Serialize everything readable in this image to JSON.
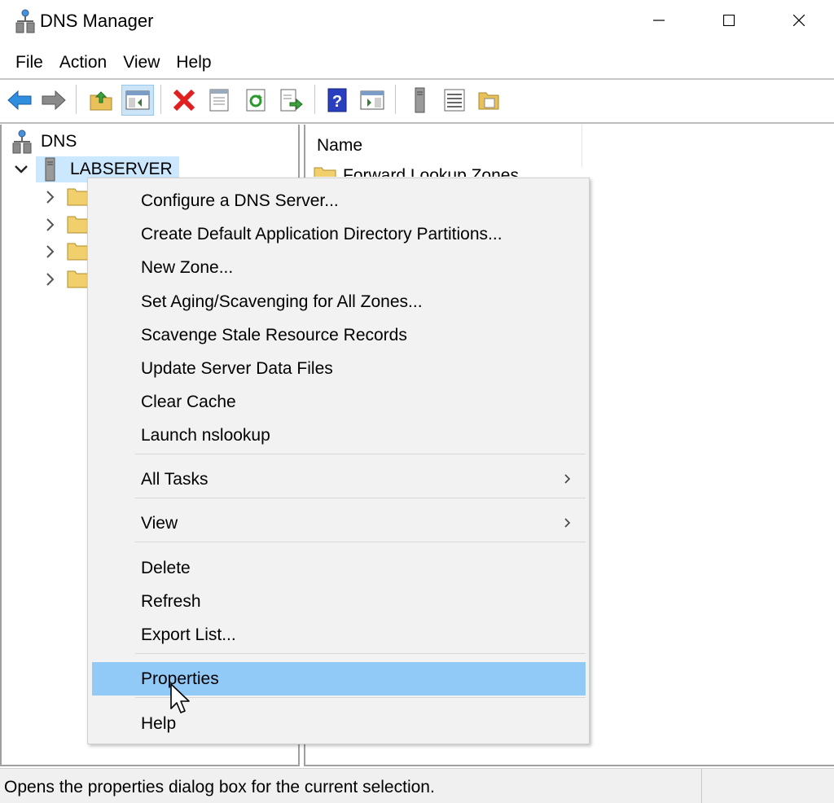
{
  "window": {
    "title": "DNS Manager",
    "icon": "dns-server-icon"
  },
  "menubar": {
    "items": [
      "File",
      "Action",
      "View",
      "Help"
    ]
  },
  "toolbar": {
    "buttons": [
      "back-arrow-icon",
      "forward-arrow-icon",
      "up-folder-icon",
      "show-hide-console-tree-icon",
      "delete-icon",
      "properties-icon",
      "refresh-icon",
      "export-list-icon",
      "help-icon",
      "show-hide-action-pane-icon",
      "server-icon",
      "list-icon",
      "folder-icon"
    ]
  },
  "tree": {
    "root": "DNS",
    "server": "LABSERVER"
  },
  "list": {
    "column_name": "Name",
    "first_item": "Forward Lookup Zones"
  },
  "context_menu": {
    "items": [
      "Configure a DNS Server...",
      "Create Default Application Directory Partitions...",
      "New Zone...",
      "Set Aging/Scavenging for All Zones...",
      "Scavenge Stale Resource Records",
      "Update Server Data Files",
      "Clear Cache",
      "Launch nslookup",
      "All Tasks",
      "View",
      "Delete",
      "Refresh",
      "Export List...",
      "Properties",
      "Help"
    ],
    "highlighted": "Properties"
  },
  "status": {
    "text": "Opens the properties dialog box for the current selection."
  },
  "colors": {
    "selection": "#cce8ff",
    "menu_highlight": "#91c9f7",
    "menu_bg": "#f2f2f2"
  }
}
